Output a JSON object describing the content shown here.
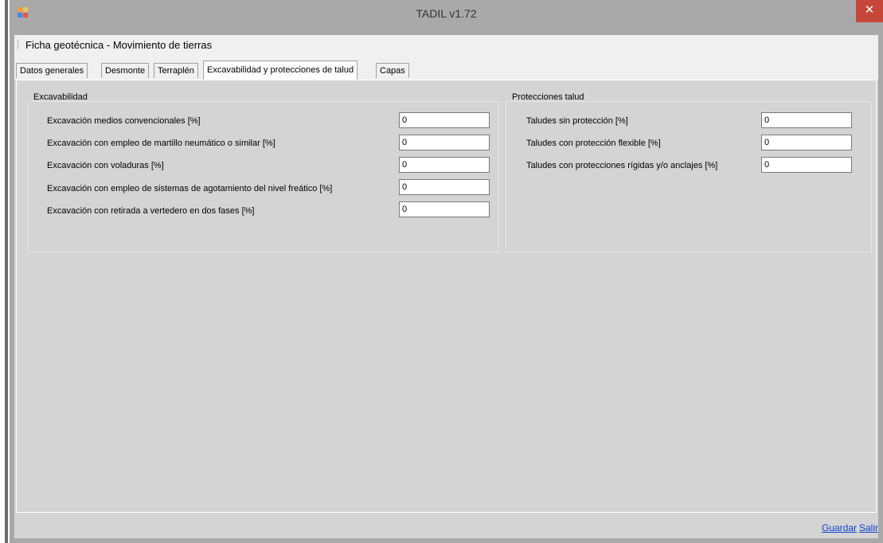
{
  "window": {
    "title": "TADIL v1.72",
    "close_glyph": "✕",
    "app_icon": "windows-app-icon"
  },
  "menu": {
    "title": "Ficha geotécnica - Movimiento de tierras"
  },
  "tabs": [
    {
      "label": "Datos generales",
      "active": false
    },
    {
      "label": "Desmonte",
      "active": false
    },
    {
      "label": "Terraplén",
      "active": false
    },
    {
      "label": "Excavabilidad y protecciones de talud",
      "active": true
    },
    {
      "label": "Capas",
      "active": false
    }
  ],
  "excavabilidad": {
    "title": "Excavabilidad",
    "fields": [
      {
        "label": "Excavación medios convencionales  [%]",
        "value": "0"
      },
      {
        "label": "Excavación con empleo de martillo neumático o similar [%]",
        "value": "0"
      },
      {
        "label": "Excavación con voladuras [%]",
        "value": "0"
      },
      {
        "label": "Excavación con empleo de sistemas de agotamiento del nivel freático  [%]",
        "value": "0"
      },
      {
        "label": "Excavación con retirada a vertedero en dos fases [%]",
        "value": "0"
      }
    ]
  },
  "protecciones": {
    "title": "Protecciones talud",
    "fields": [
      {
        "label": "Taludes sin protección [%]",
        "value": "0"
      },
      {
        "label": "Taludes con protección flexible [%]",
        "value": "0"
      },
      {
        "label": "Taludes con protecciones rígidas y/o anclajes [%]",
        "value": "0"
      }
    ]
  },
  "footer": {
    "save_label": "Guardar",
    "exit_label": "Salir"
  },
  "colors": {
    "title_bar": "#a9a9a9",
    "close_button": "#c7463a",
    "link": "#0a3fcf",
    "client_bg": "#d4d4d4"
  }
}
